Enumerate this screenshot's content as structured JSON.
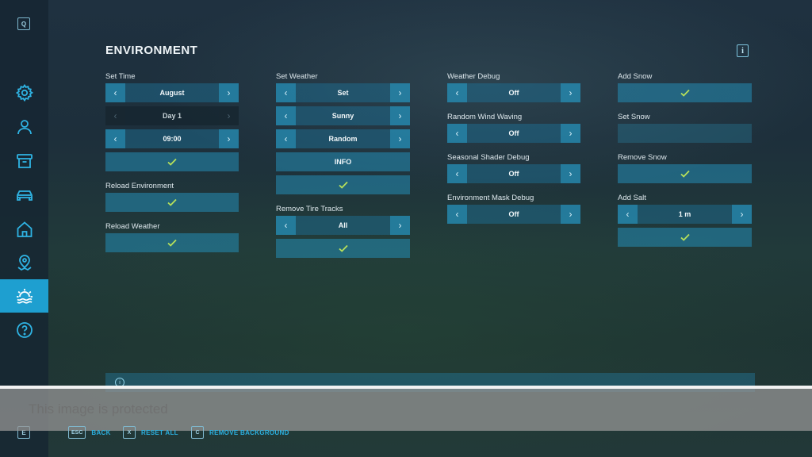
{
  "sidebar": {
    "top_key": "Q",
    "bottom_key": "E",
    "items": [
      {
        "icon": "gear-icon"
      },
      {
        "icon": "person-icon"
      },
      {
        "icon": "box-icon"
      },
      {
        "icon": "vehicle-icon"
      },
      {
        "icon": "home-icon"
      },
      {
        "icon": "map-pin-icon"
      },
      {
        "icon": "sunrise-icon",
        "active": true
      },
      {
        "icon": "help-icon"
      }
    ],
    "active_color": "#1e9fd0"
  },
  "page": {
    "title": "ENVIRONMENT",
    "info_glyph": "i"
  },
  "col1": {
    "set_time_label": "Set Time",
    "month_value": "August",
    "day_value": "Day 1",
    "time_value": "09:00",
    "reload_env_label": "Reload Environment",
    "reload_weather_label": "Reload Weather"
  },
  "col2": {
    "set_weather_label": "Set Weather",
    "mode_value": "Set",
    "weather_value": "Sunny",
    "variation_value": "Random",
    "info_label": "INFO",
    "remove_tracks_label": "Remove Tire Tracks",
    "tracks_value": "All"
  },
  "col3": {
    "weather_debug_label": "Weather Debug",
    "weather_debug_value": "Off",
    "wind_label": "Random Wind Waving",
    "wind_value": "Off",
    "shader_label": "Seasonal Shader Debug",
    "shader_value": "Off",
    "mask_label": "Environment Mask Debug",
    "mask_value": "Off"
  },
  "col4": {
    "add_snow_label": "Add Snow",
    "set_snow_label": "Set Snow",
    "remove_snow_label": "Remove Snow",
    "add_salt_label": "Add Salt",
    "salt_value": "1 m"
  },
  "tipbar": {
    "icon": "info-icon",
    "text": ""
  },
  "overlay": {
    "watermark": "This image is protected"
  },
  "footer": {
    "back_key": "ESC",
    "back_label": "BACK",
    "reset_key": "X",
    "reset_label": "RESET ALL",
    "remove_bg_key": "C",
    "remove_bg_label": "REMOVE BACKGROUND"
  },
  "colors": {
    "accent": "#1e9fd0",
    "check": "#b7e05a",
    "footer_text": "#2bb0e0"
  }
}
